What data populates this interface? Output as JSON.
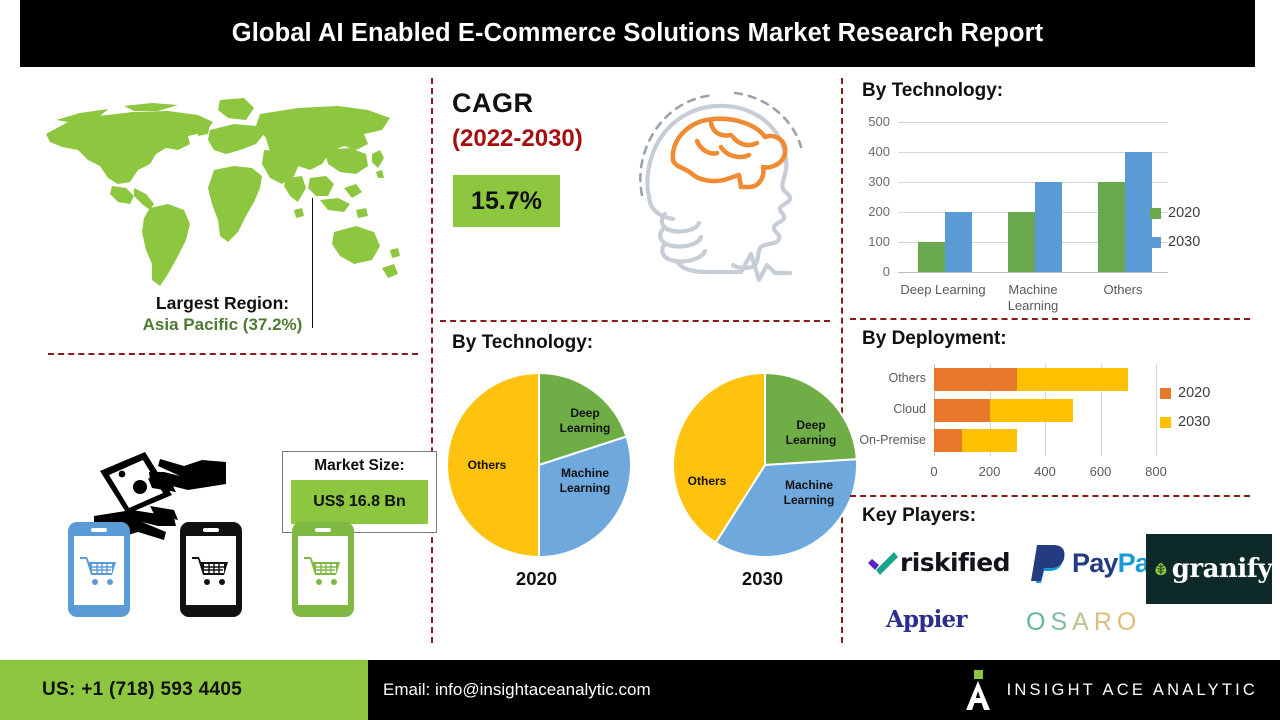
{
  "header": {
    "title": "Global AI Enabled E-Commerce Solutions Market Research Report"
  },
  "colors": {
    "green": "#8DC63F",
    "dark_green": "#4E7A31",
    "bar_green": "#6AA84F",
    "bar_blue": "#5B9BD5",
    "pie_yellow": "#FFC20E",
    "pie_green": "#6FAE46",
    "pie_blue": "#6EA8DC",
    "deploy_orange": "#E8792B",
    "deploy_yellow": "#FFC000",
    "accent_red": "#A50F0F",
    "divider_red": "#8B1A1A",
    "black": "#000000"
  },
  "left": {
    "map_icon": "world-map-icon",
    "largest_region_label": "Largest Region:",
    "largest_region_value": "Asia Pacific (37.2%)",
    "money_icon": "money-in-hands-icon",
    "market_size_label": "Market Size:",
    "market_size_value": "US$ 16.8 Bn",
    "phones": [
      {
        "icon": "mobile-shopping-cart-icon",
        "color": "#5B9BD5"
      },
      {
        "icon": "mobile-shopping-cart-icon",
        "color": "#111111"
      },
      {
        "icon": "mobile-shopping-cart-icon",
        "color": "#7FB842"
      }
    ]
  },
  "middle": {
    "cagr_label": "CAGR",
    "cagr_range": "(2022-2030)",
    "cagr_value": "15.7%",
    "brain_icon": "ai-brain-head-lightbulb-icon",
    "tech_title": "By Technology:"
  },
  "right": {
    "tech_title": "By Technology:",
    "deployment_title": "By Deployment:",
    "players_title": "Key Players:",
    "players": [
      {
        "name": "riskified",
        "label": "riskified"
      },
      {
        "name": "paypal",
        "label": "PayPal"
      },
      {
        "name": "granify",
        "label": "granify"
      },
      {
        "name": "appier",
        "label": "Appier"
      },
      {
        "name": "osaro",
        "label": "OSARO"
      }
    ]
  },
  "footer": {
    "phone": "US: +1 (718) 593 4405",
    "email": "Email: info@insightaceanalytic.com",
    "brand": "INSIGHT ACE ANALYTIC",
    "brand_mark": "insight-ace-a-logo-icon"
  },
  "chart_data": [
    {
      "type": "bar",
      "id": "by-technology-bars",
      "title": "By Technology:",
      "orientation": "vertical",
      "categories": [
        "Deep Learning",
        "Machine Learning",
        "Others"
      ],
      "series": [
        {
          "name": "2020",
          "values": [
            100,
            200,
            300
          ],
          "color": "#6AA84F"
        },
        {
          "name": "2030",
          "values": [
            200,
            300,
            400
          ],
          "color": "#5B9BD5"
        }
      ],
      "ylim": [
        0,
        500
      ],
      "yticks": [
        0,
        100,
        200,
        300,
        400,
        500
      ],
      "xlabel": "",
      "ylabel": "",
      "grid": true,
      "legend_position": "right"
    },
    {
      "type": "pie",
      "id": "by-technology-pie-2020",
      "title": "By Technology:",
      "year_label": "2020",
      "labels": [
        "Deep Learning",
        "Machine Learning",
        "Others"
      ],
      "values": [
        20,
        30,
        50
      ],
      "colors": [
        "#6FAE46",
        "#6EA8DC",
        "#FFC20E"
      ],
      "start_angle_deg": 0
    },
    {
      "type": "pie",
      "id": "by-technology-pie-2030",
      "title": "By Technology:",
      "year_label": "2030",
      "labels": [
        "Deep Learning",
        "Machine Learning",
        "Others"
      ],
      "values": [
        24,
        35,
        41
      ],
      "colors": [
        "#6FAE46",
        "#6EA8DC",
        "#FFC20E"
      ],
      "start_angle_deg": 0
    },
    {
      "type": "bar",
      "id": "by-deployment-bars",
      "title": "By Deployment:",
      "orientation": "horizontal",
      "stacked": true,
      "categories": [
        "On-Premise",
        "Cloud",
        "Others"
      ],
      "series": [
        {
          "name": "2020",
          "values": [
            100,
            200,
            300
          ],
          "color": "#E8792B"
        },
        {
          "name": "2030",
          "values": [
            200,
            300,
            400
          ],
          "color": "#FFC000"
        }
      ],
      "xlim": [
        0,
        800
      ],
      "xticks": [
        0,
        200,
        400,
        600,
        800
      ],
      "grid": true,
      "legend_position": "right"
    }
  ]
}
